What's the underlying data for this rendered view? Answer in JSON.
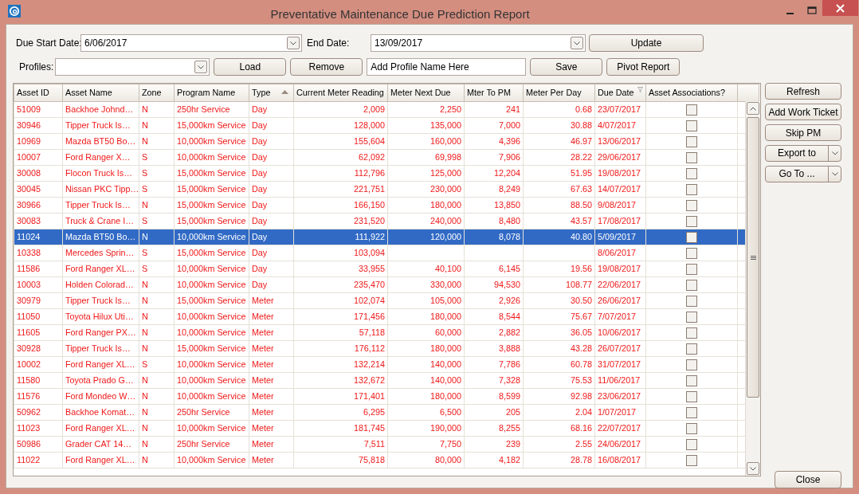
{
  "window": {
    "title": "Preventative Maintenance Due Prediction Report"
  },
  "filters": {
    "due_start_date": {
      "label": "Due Start Date:",
      "value": "6/06/2017"
    },
    "end_date": {
      "label": "End Date:",
      "value": "13/09/2017"
    },
    "update_button": "Update"
  },
  "profiles": {
    "label": "Profiles:",
    "load_button": "Load",
    "remove_button": "Remove",
    "name_field": "Add Profile Name Here",
    "save_button": "Save",
    "pivot_button": "Pivot Report"
  },
  "table": {
    "columns": [
      {
        "label": "Asset ID",
        "sorted": false,
        "filtered": false
      },
      {
        "label": "Asset Name",
        "sorted": false,
        "filtered": false
      },
      {
        "label": "Zone",
        "sorted": false,
        "filtered": false
      },
      {
        "label": "Program Name",
        "sorted": false,
        "filtered": false
      },
      {
        "label": "Type",
        "sorted": true,
        "filtered": false
      },
      {
        "label": "Current Meter Reading",
        "sorted": false,
        "filtered": false
      },
      {
        "label": "Meter Next Due",
        "sorted": false,
        "filtered": false
      },
      {
        "label": "Mter To PM",
        "sorted": false,
        "filtered": false
      },
      {
        "label": "Meter Per Day",
        "sorted": false,
        "filtered": false
      },
      {
        "label": "Due Date",
        "sorted": false,
        "filtered": true
      },
      {
        "label": "Asset Associations?",
        "sorted": false,
        "filtered": false
      }
    ],
    "rows": [
      {
        "asset_id": "51009",
        "asset_name": "Backhoe Johnd…",
        "zone": "N",
        "program_name": "250hr Service",
        "type": "Day",
        "current_meter_reading": "2,009",
        "meter_next_due": "2,250",
        "mter_to_pm": "241",
        "meter_per_day": "0.68",
        "due_date": "23/07/2017",
        "asset_associations": false,
        "selected": false
      },
      {
        "asset_id": "30946",
        "asset_name": "Tipper Truck Is…",
        "zone": "N",
        "program_name": "15,000km Service",
        "type": "Day",
        "current_meter_reading": "128,000",
        "meter_next_due": "135,000",
        "mter_to_pm": "7,000",
        "meter_per_day": "30.88",
        "due_date": "4/07/2017",
        "asset_associations": false,
        "selected": false
      },
      {
        "asset_id": "10969",
        "asset_name": "Mazda BT50 Bo…",
        "zone": "N",
        "program_name": "10,000km Service",
        "type": "Day",
        "current_meter_reading": "155,604",
        "meter_next_due": "160,000",
        "mter_to_pm": "4,396",
        "meter_per_day": "46.97",
        "due_date": "13/06/2017",
        "asset_associations": false,
        "selected": false
      },
      {
        "asset_id": "10007",
        "asset_name": "Ford Ranger  X…",
        "zone": "S",
        "program_name": "10,000km Service",
        "type": "Day",
        "current_meter_reading": "62,092",
        "meter_next_due": "69,998",
        "mter_to_pm": "7,906",
        "meter_per_day": "28.22",
        "due_date": "29/06/2017",
        "asset_associations": false,
        "selected": false
      },
      {
        "asset_id": "30008",
        "asset_name": "Flocon Truck Is…",
        "zone": "S",
        "program_name": "15,000km Service",
        "type": "Day",
        "current_meter_reading": "112,796",
        "meter_next_due": "125,000",
        "mter_to_pm": "12,204",
        "meter_per_day": "51.95",
        "due_date": "19/08/2017",
        "asset_associations": false,
        "selected": false
      },
      {
        "asset_id": "30045",
        "asset_name": "Nissan PKC Tipp…",
        "zone": "S",
        "program_name": "15,000km Service",
        "type": "Day",
        "current_meter_reading": "221,751",
        "meter_next_due": "230,000",
        "mter_to_pm": "8,249",
        "meter_per_day": "67.63",
        "due_date": "14/07/2017",
        "asset_associations": false,
        "selected": false
      },
      {
        "asset_id": "30966",
        "asset_name": "Tipper Truck Is…",
        "zone": "N",
        "program_name": "15,000km Service",
        "type": "Day",
        "current_meter_reading": "166,150",
        "meter_next_due": "180,000",
        "mter_to_pm": "13,850",
        "meter_per_day": "88.50",
        "due_date": "9/08/2017",
        "asset_associations": false,
        "selected": false
      },
      {
        "asset_id": "30083",
        "asset_name": "Truck & Crane I…",
        "zone": "S",
        "program_name": "15,000km Service",
        "type": "Day",
        "current_meter_reading": "231,520",
        "meter_next_due": "240,000",
        "mter_to_pm": "8,480",
        "meter_per_day": "43.57",
        "due_date": "17/08/2017",
        "asset_associations": false,
        "selected": false
      },
      {
        "asset_id": "11024",
        "asset_name": "Mazda BT50 Bo…",
        "zone": "N",
        "program_name": "10,000km Service",
        "type": "Day",
        "current_meter_reading": "111,922",
        "meter_next_due": "120,000",
        "mter_to_pm": "8,078",
        "meter_per_day": "40.80",
        "due_date": "5/09/2017",
        "asset_associations": false,
        "selected": true
      },
      {
        "asset_id": "10338",
        "asset_name": "Mercedes Sprin…",
        "zone": "S",
        "program_name": "15,000km Service",
        "type": "Day",
        "current_meter_reading": "103,094",
        "due_date": "8/06/2017",
        "asset_associations": false,
        "selected": false
      },
      {
        "asset_id": "11586",
        "asset_name": "Ford Ranger XL…",
        "zone": "S",
        "program_name": "10,000km Service",
        "type": "Day",
        "current_meter_reading": "33,955",
        "meter_next_due": "40,100",
        "mter_to_pm": "6,145",
        "meter_per_day": "19.56",
        "due_date": "19/08/2017",
        "asset_associations": false,
        "selected": false
      },
      {
        "asset_id": "10003",
        "asset_name": "Holden Colorad…",
        "zone": "N",
        "program_name": "10,000km Service",
        "type": "Day",
        "current_meter_reading": "235,470",
        "meter_next_due": "330,000",
        "mter_to_pm": "94,530",
        "meter_per_day": "108.77",
        "due_date": "22/06/2017",
        "asset_associations": false,
        "selected": false
      },
      {
        "asset_id": "30979",
        "asset_name": "Tipper Truck Is…",
        "zone": "N",
        "program_name": "15,000km Service",
        "type": "Meter",
        "current_meter_reading": "102,074",
        "meter_next_due": "105,000",
        "mter_to_pm": "2,926",
        "meter_per_day": "30.50",
        "due_date": "26/06/2017",
        "asset_associations": false,
        "selected": false
      },
      {
        "asset_id": "11050",
        "asset_name": "Toyota Hilux Uti…",
        "zone": "N",
        "program_name": "10,000km Service",
        "type": "Meter",
        "current_meter_reading": "171,456",
        "meter_next_due": "180,000",
        "mter_to_pm": "8,544",
        "meter_per_day": "75.67",
        "due_date": "7/07/2017",
        "asset_associations": false,
        "selected": false
      },
      {
        "asset_id": "11605",
        "asset_name": "Ford Ranger PX…",
        "zone": "N",
        "program_name": "10,000km Service",
        "type": "Meter",
        "current_meter_reading": "57,118",
        "meter_next_due": "60,000",
        "mter_to_pm": "2,882",
        "meter_per_day": "36.05",
        "due_date": "10/06/2017",
        "asset_associations": false,
        "selected": false
      },
      {
        "asset_id": "30928",
        "asset_name": "Tipper Truck Is…",
        "zone": "N",
        "program_name": "15,000km Service",
        "type": "Meter",
        "current_meter_reading": "176,112",
        "meter_next_due": "180,000",
        "mter_to_pm": "3,888",
        "meter_per_day": "43.28",
        "due_date": "26/07/2017",
        "asset_associations": false,
        "selected": false
      },
      {
        "asset_id": "10002",
        "asset_name": "Ford Ranger XL…",
        "zone": "S",
        "program_name": "10,000km Service",
        "type": "Meter",
        "current_meter_reading": "132,214",
        "meter_next_due": "140,000",
        "mter_to_pm": "7,786",
        "meter_per_day": "60.78",
        "due_date": "31/07/2017",
        "asset_associations": false,
        "selected": false
      },
      {
        "asset_id": "11580",
        "asset_name": "Toyota Prado G…",
        "zone": "N",
        "program_name": "10,000km Service",
        "type": "Meter",
        "current_meter_reading": "132,672",
        "meter_next_due": "140,000",
        "mter_to_pm": "7,328",
        "meter_per_day": "75.53",
        "due_date": "11/06/2017",
        "asset_associations": false,
        "selected": false
      },
      {
        "asset_id": "11576",
        "asset_name": "Ford Mondeo W…",
        "zone": "N",
        "program_name": "10,000km Service",
        "type": "Meter",
        "current_meter_reading": "171,401",
        "meter_next_due": "180,000",
        "mter_to_pm": "8,599",
        "meter_per_day": "92.98",
        "due_date": "23/06/2017",
        "asset_associations": false,
        "selected": false
      },
      {
        "asset_id": "50962",
        "asset_name": "Backhoe Komat…",
        "zone": "N",
        "program_name": "250hr Service",
        "type": "Meter",
        "current_meter_reading": "6,295",
        "meter_next_due": "6,500",
        "mter_to_pm": "205",
        "meter_per_day": "2.04",
        "due_date": "1/07/2017",
        "asset_associations": false,
        "selected": false
      },
      {
        "asset_id": "11023",
        "asset_name": "Ford Ranger XL…",
        "zone": "N",
        "program_name": "10,000km Service",
        "type": "Meter",
        "current_meter_reading": "181,745",
        "meter_next_due": "190,000",
        "mter_to_pm": "8,255",
        "meter_per_day": "68.16",
        "due_date": "22/07/2017",
        "asset_associations": false,
        "selected": false
      },
      {
        "asset_id": "50986",
        "asset_name": "Grader CAT 14…",
        "zone": "N",
        "program_name": "250hr Service",
        "type": "Meter",
        "current_meter_reading": "7,511",
        "meter_next_due": "7,750",
        "mter_to_pm": "239",
        "meter_per_day": "2.55",
        "due_date": "24/06/2017",
        "asset_associations": false,
        "selected": false
      },
      {
        "asset_id": "11022",
        "asset_name": "Ford Ranger XL…",
        "zone": "N",
        "program_name": "10,000km Service",
        "type": "Meter",
        "current_meter_reading": "75,818",
        "meter_next_due": "80,000",
        "mter_to_pm": "4,182",
        "meter_per_day": "28.78",
        "due_date": "16/08/2017",
        "asset_associations": false,
        "selected": false
      }
    ]
  },
  "side_buttons": [
    {
      "label": "Refresh",
      "kind": "button"
    },
    {
      "label": "Add Work Ticket",
      "kind": "button"
    },
    {
      "label": "Skip PM",
      "kind": "button"
    },
    {
      "label": "Export to",
      "kind": "split"
    },
    {
      "label": "Go To ...",
      "kind": "split"
    }
  ],
  "close_button": "Close"
}
